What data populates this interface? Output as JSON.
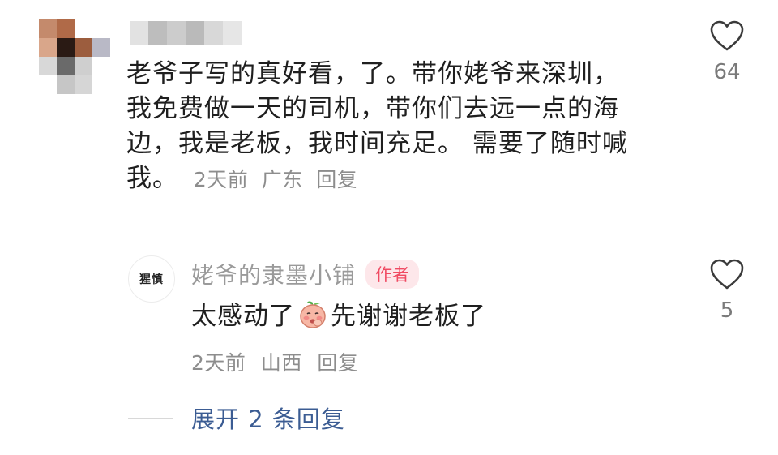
{
  "comment": {
    "username_blurred": true,
    "text_lines": [
      "老爷子写的真好看，了。带你姥爷来深圳，",
      "我免费做一天的司机，带你们去远一点的海",
      "边，我是老板，我时间充足。 需要了随时喊"
    ],
    "last_line": "我。",
    "time": "2天前",
    "location": "广东",
    "reply_label": "回复",
    "likes": "64",
    "icons": {
      "like": "heart-outline-icon"
    }
  },
  "reply": {
    "avatar_text": "猩慎",
    "name": "姥爷的隶墨小铺",
    "badge": "作者",
    "text_before": "太感动了",
    "emoji": "peach-blush-emoji",
    "text_after": "先谢谢老板了",
    "time": "2天前",
    "location": "山西",
    "reply_label": "回复",
    "likes": "5"
  },
  "expand": {
    "label": "展开 2 条回复"
  },
  "colors": {
    "text_primary": "#1f1f1f",
    "text_secondary": "#8d8d8d",
    "link_blue": "#3b5c93",
    "author_badge_bg": "#fde7ea",
    "author_badge_fg": "#f04a62"
  }
}
